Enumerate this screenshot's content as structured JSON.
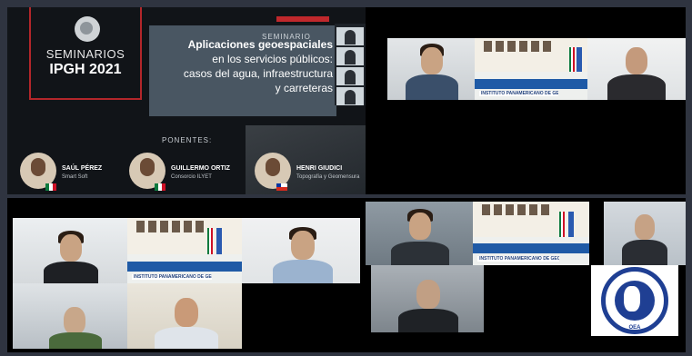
{
  "slide": {
    "series_label": "SEMINARIOS",
    "series_year": "IPGH 2021",
    "seminario_tag": "SEMINARIO",
    "title_line1": "Aplicaciones geoespaciales",
    "title_line2": "en los servicios públicos:",
    "title_line3": "casos del agua, infraestructura",
    "title_line4": "y carreteras",
    "ponentes_label": "PONENTES:",
    "speakers": [
      {
        "name": "SAÚL PÉREZ",
        "org": "Smart Soft",
        "flag": "mexico"
      },
      {
        "name": "GUILLERMO ORTIZ",
        "org": "Consorcio ILYET",
        "flag": "mexico"
      },
      {
        "name": "HENRI GIUDICI",
        "org": "Topografía y Geomensura",
        "flag": "chile"
      }
    ]
  },
  "room_banner": "INSTITUTO PANAMERICANO DE GEOGRAFÍA E HISTORIA",
  "logo_caption": "OEA",
  "colors": {
    "background": "#2f3440",
    "brand_red": "#c0282c",
    "ipgh_blue": "#1f3f93"
  }
}
